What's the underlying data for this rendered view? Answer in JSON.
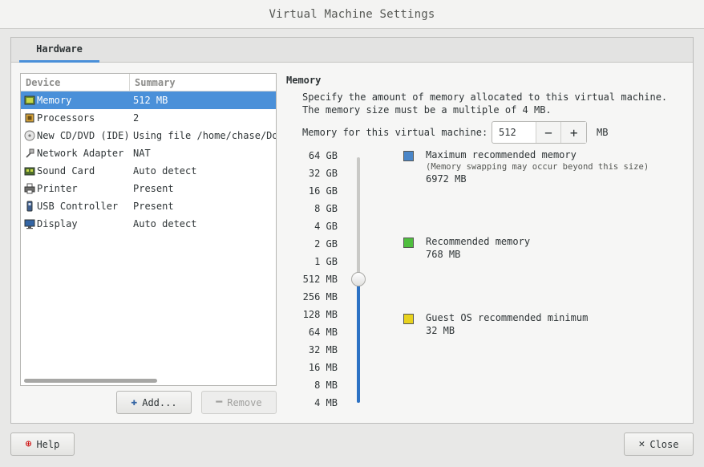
{
  "window": {
    "title": "Virtual Machine Settings"
  },
  "tabs": [
    {
      "label": "Hardware"
    }
  ],
  "device_list": {
    "headers": {
      "device": "Device",
      "summary": "Summary"
    },
    "rows": [
      {
        "name": "Memory",
        "summary": "512 MB",
        "icon": "memory-icon",
        "selected": true
      },
      {
        "name": "Processors",
        "summary": "2",
        "icon": "processor-icon"
      },
      {
        "name": "New CD/DVD (IDE)",
        "summary": "Using file /home/chase/Dow",
        "icon": "cd-dvd-icon"
      },
      {
        "name": "Network Adapter",
        "summary": "NAT",
        "icon": "network-adapter-icon"
      },
      {
        "name": "Sound Card",
        "summary": "Auto detect",
        "icon": "sound-card-icon"
      },
      {
        "name": "Printer",
        "summary": "Present",
        "icon": "printer-icon"
      },
      {
        "name": "USB Controller",
        "summary": "Present",
        "icon": "usb-controller-icon"
      },
      {
        "name": "Display",
        "summary": "Auto detect",
        "icon": "display-icon"
      }
    ]
  },
  "buttons": {
    "add": "Add...",
    "remove": "Remove",
    "help": "Help",
    "close": "Close"
  },
  "memory": {
    "title": "Memory",
    "description": "Specify the amount of memory allocated to this virtual machine. The memory size must be a multiple of 4 MB.",
    "field_label": "Memory for this virtual machine:",
    "value": "512",
    "unit": "MB",
    "scale_labels": [
      "64 GB",
      "32 GB",
      "16 GB",
      "8 GB",
      "4 GB",
      "2 GB",
      "1 GB",
      "512 MB",
      "256 MB",
      "128 MB",
      "64 MB",
      "32 MB",
      "16 MB",
      "8 MB",
      "4 MB"
    ],
    "slider_selected_label": "512 MB",
    "legend": [
      {
        "title": "Maximum recommended memory",
        "note": "(Memory swapping may occur beyond this size)",
        "value": "6972 MB",
        "color": "#4a86c8"
      },
      {
        "title": "Recommended memory",
        "note": "",
        "value": "768 MB",
        "color": "#4fbe3e"
      },
      {
        "title": "Guest OS recommended minimum",
        "note": "",
        "value": "32 MB",
        "color": "#e8d21e"
      }
    ]
  },
  "colors": {
    "accent": "#4a90d9",
    "slider_fill": "#2d72c4"
  }
}
